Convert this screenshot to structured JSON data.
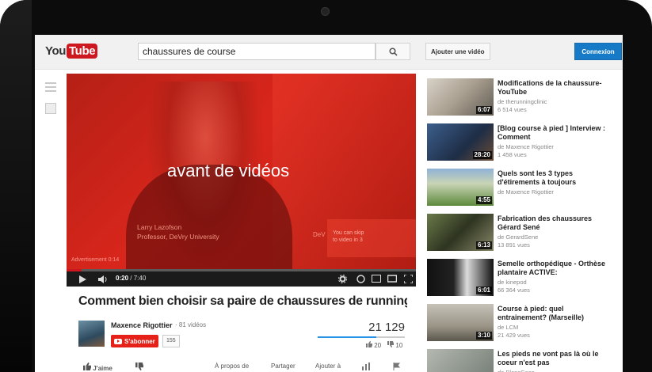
{
  "header": {
    "logo_you": "You",
    "logo_tube": "Tube",
    "search_value": "chaussures de course",
    "upload_label": "Ajouter une vidéo",
    "login_label": "Connexion"
  },
  "player": {
    "overlay_title": "avant de vidéos",
    "presenter_name": "Larry Lazofson",
    "presenter_title": "Professor, DeVry University",
    "skip_brand": "DeV",
    "skip_line1": "You can skip",
    "skip_line2": "to video in 3",
    "ad_label": "Advertisement 0:14",
    "time_current": "0:20",
    "time_total": "7:40",
    "progress_fraction": 0.043
  },
  "video": {
    "title": "Comment bien choisir sa paire de chaussures de running en cour…",
    "channel": "Maxence Rigottier",
    "channel_videos": "· 81 vidéos",
    "subscribe_label": "S'abonner",
    "subscriber_count": "155",
    "views": "21 129",
    "likes": "20",
    "dislikes": "10",
    "like_ratio": 0.67
  },
  "actions": {
    "like": "J'aime",
    "about": "À propos de",
    "share": "Partager",
    "add_to": "Ajouter à"
  },
  "sidebar": [
    {
      "title": "Modifications de la chaussure-YouTube",
      "channel": "de therunningclinic",
      "views": "6 514 vues",
      "duration": "6:07"
    },
    {
      "title": "[Blog course à pied ] Interview : Comment",
      "channel": "de Maxence Rigottier",
      "views": "1 458 vues",
      "duration": "28:20"
    },
    {
      "title": "Quels sont les 3 types d'étirements à toujours",
      "channel": "de Maxence Rigottier",
      "views": "",
      "duration": "4:55"
    },
    {
      "title": "Fabrication des chaussures Gérard Sené",
      "channel": "de GerardSene",
      "views": "13 891 vues",
      "duration": "6:13"
    },
    {
      "title": "Semelle orthopédique - Orthèse plantaire ACTIVE:",
      "channel": "de kinepod",
      "views": "66 364 vues",
      "duration": "6:01"
    },
    {
      "title": "Course à pied: quel entrainement? (Marseille)",
      "channel": "de LCM",
      "views": "21 429 vues",
      "duration": "3:10"
    },
    {
      "title": "Les pieds ne vont pas là où le coeur n'est pas",
      "channel": "de BlancCaca",
      "views": "",
      "duration": ""
    }
  ],
  "colors": {
    "brand_red": "#cc181e",
    "login_blue": "#167ac6",
    "like_blue": "#2793e6"
  }
}
